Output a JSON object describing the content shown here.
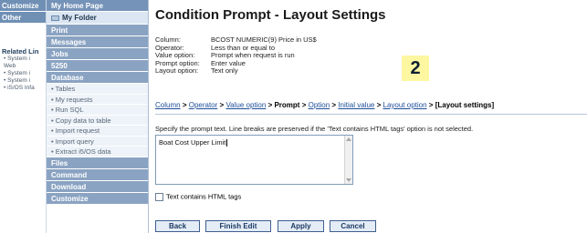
{
  "far_left": {
    "tabs": [
      "Customize",
      "Other"
    ],
    "related_label": "Related Lin",
    "links": [
      "• System i",
      "  Web",
      "• System i",
      "• System i",
      "• iS/OS Infa"
    ]
  },
  "nav": {
    "home": "My Home Page",
    "folder": "My Folder",
    "categories_top": [
      "Print",
      "Messages",
      "Jobs",
      "5250",
      "Database"
    ],
    "database_items": [
      "• Tables",
      "• My requests",
      "• Run SQL",
      "• Copy data to table",
      "• Import request",
      "• Import query",
      "• Extract i5/OS data"
    ],
    "categories_bottom": [
      "Files",
      "Command",
      "Download",
      "Customize"
    ]
  },
  "main": {
    "title": "Condition Prompt - Layout Settings",
    "info": [
      {
        "label": "Column:",
        "value": "BCOST   NUMERIC(9)   Price in US$"
      },
      {
        "label": "Operator:",
        "value": "Less than or equal to"
      },
      {
        "label": "Value option:",
        "value": "Prompt when request is run"
      },
      {
        "label": "Prompt option:",
        "value": "Enter value"
      },
      {
        "label": "Layout option:",
        "value": "Text only"
      }
    ],
    "step_badge": "2",
    "breadcrumbs": {
      "column": "Column",
      "operator": "Operator",
      "value_option": "Value option",
      "prompt": "Prompt",
      "option": "Option",
      "initial_value": "Initial value",
      "layout_option": "Layout option",
      "layout_settings": "[Layout settings]",
      "separator": ">"
    },
    "instruction": "Specify the prompt text. Line breaks are preserved if the 'Text contains HTML tags' option is not selected.",
    "prompt_text": "Boat Cost Upper Limit",
    "html_tags_label": "Text contains HTML tags",
    "html_tags_checked": false,
    "buttons": {
      "back": "Back",
      "finish_edit": "Finish Edit",
      "apply": "Apply",
      "cancel": "Cancel"
    }
  }
}
